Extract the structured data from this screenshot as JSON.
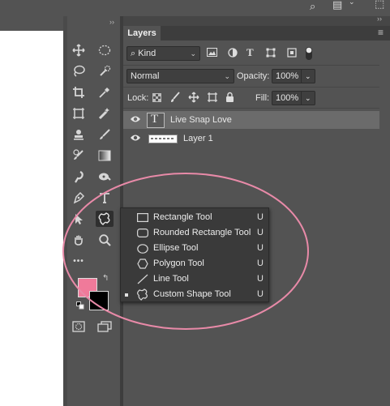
{
  "layers_panel": {
    "tab_label": "Layers",
    "filter": {
      "icon": "search-icon",
      "kind_value": "Kind"
    },
    "blend_mode": "Normal",
    "opacity_label": "Opacity:",
    "opacity_value": "100%",
    "lock_label": "Lock:",
    "fill_label": "Fill:",
    "fill_value": "100%",
    "layers": [
      {
        "name": "Live Snap Love",
        "type": "text",
        "selected": true
      },
      {
        "name": "Layer 1",
        "type": "pixel",
        "selected": false
      }
    ]
  },
  "shape_flyout": {
    "items": [
      {
        "label": "Rectangle Tool",
        "shortcut": "U",
        "icon": "rectangle-icon",
        "selected": false
      },
      {
        "label": "Rounded Rectangle Tool",
        "shortcut": "U",
        "icon": "rounded-rectangle-icon",
        "selected": false
      },
      {
        "label": "Ellipse Tool",
        "shortcut": "U",
        "icon": "ellipse-icon",
        "selected": false
      },
      {
        "label": "Polygon Tool",
        "shortcut": "U",
        "icon": "polygon-icon",
        "selected": false
      },
      {
        "label": "Line Tool",
        "shortcut": "U",
        "icon": "line-icon",
        "selected": false
      },
      {
        "label": "Custom Shape Tool",
        "shortcut": "U",
        "icon": "custom-shape-icon",
        "selected": true
      }
    ]
  },
  "toolbar": {
    "more_tools": "•••",
    "foreground_color": "#f07a9a",
    "background_color": "#000000"
  },
  "colors": {
    "annotation": "#e88aa8",
    "panel_bg": "#535353",
    "flyout_bg": "#3a3a3a"
  }
}
